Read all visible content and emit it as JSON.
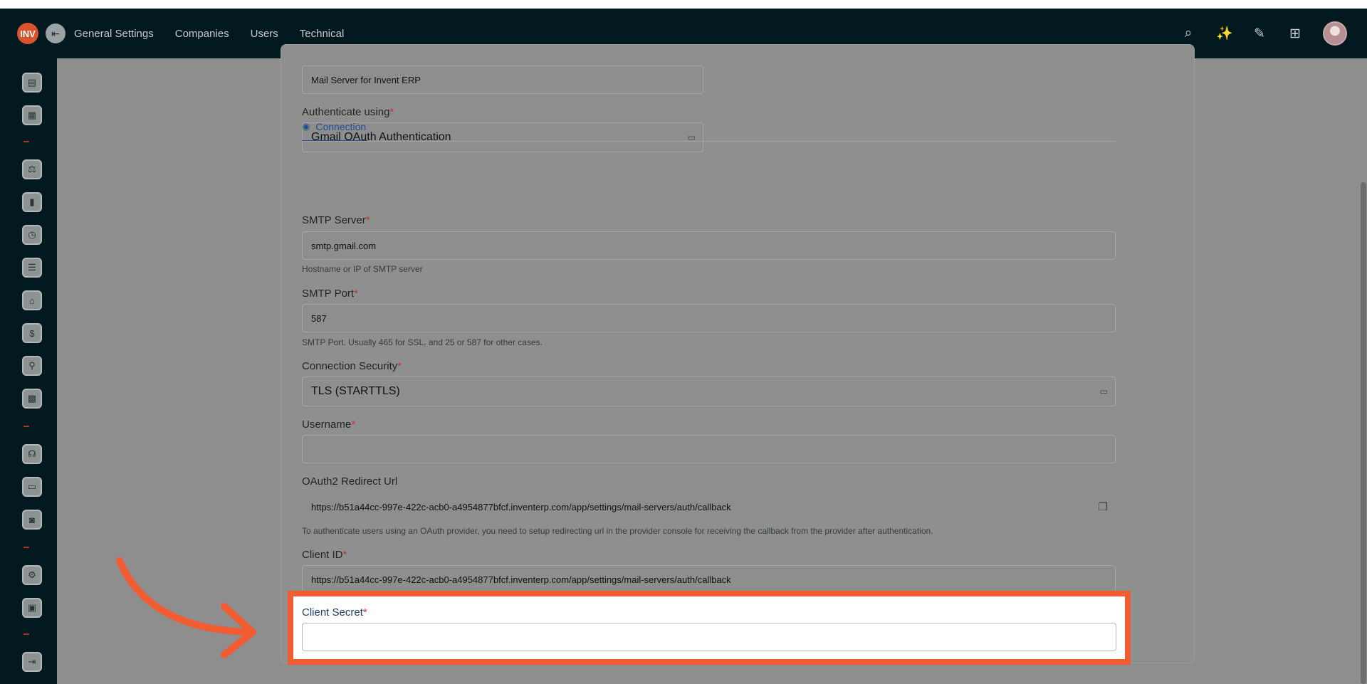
{
  "topbar": {
    "logo_text": "INV",
    "nav": [
      "General Settings",
      "Companies",
      "Users",
      "Technical"
    ],
    "actions": [
      "search-icon",
      "magic-wand-icon",
      "bandage-icon",
      "apps-grid-icon",
      "user-avatar"
    ]
  },
  "sidebar": {
    "icons": [
      "dashboard-icon",
      "inventory-icon",
      "sales-icon",
      "reports-icon",
      "calendar-icon",
      "clipboard-icon",
      "warehouse-icon",
      "payments-icon",
      "search-people-icon",
      "calculator-icon",
      "support-icon",
      "documents-icon",
      "monitor-icon",
      "settings-icon",
      "contacts-icon",
      "logout-icon"
    ]
  },
  "form": {
    "name_value": "Mail Server for Invent ERP",
    "authenticate": {
      "label": "Authenticate using",
      "value": "Gmail OAuth Authentication"
    },
    "tab_label": "Connection",
    "smtp_server": {
      "label": "SMTP Server",
      "value": "smtp.gmail.com",
      "hint": "Hostname or IP of SMTP server"
    },
    "smtp_port": {
      "label": "SMTP Port",
      "value": "587",
      "hint": "SMTP Port. Usually 465 for SSL, and 25 or 587 for other cases."
    },
    "connection_security": {
      "label": "Connection Security",
      "value": "TLS (STARTTLS)"
    },
    "username": {
      "label": "Username",
      "value": ""
    },
    "oauth_redirect": {
      "label": "OAuth2 Redirect Url",
      "value": "https://b51a44cc-997e-422c-acb0-a4954877bfcf.inventerp.com/app/settings/mail-servers/auth/callback",
      "hint": "To authenticate users using an OAuth provider, you need to setup redirecting url in the provider console for receiving the callback from the provider after authentication."
    },
    "client_id": {
      "label": "Client ID",
      "value": "https://b51a44cc-997e-422c-acb0-a4954877bfcf.inventerp.com/app/settings/mail-servers/auth/callback"
    },
    "client_secret": {
      "label": "Client Secret",
      "value": ""
    },
    "required_mark": "*"
  },
  "colors": {
    "topbar": "#021a1f",
    "highlight": "#f25c33",
    "accent": "#1f4f8f",
    "required": "#c8322a"
  }
}
